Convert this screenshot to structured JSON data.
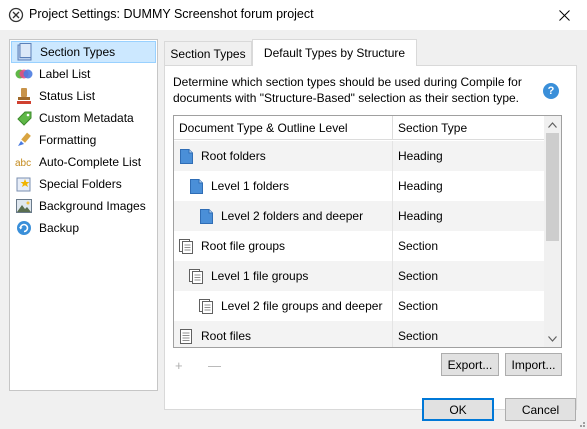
{
  "window": {
    "title": "Project Settings: DUMMY Screenshot forum project",
    "app_icon": "scrivener-app-icon",
    "close_icon": "close-icon"
  },
  "sidebar": {
    "items": [
      {
        "label": "Section Types",
        "icon": "section-types-icon",
        "selected": true
      },
      {
        "label": "Label List",
        "icon": "label-list-icon",
        "selected": false
      },
      {
        "label": "Status List",
        "icon": "status-list-icon",
        "selected": false
      },
      {
        "label": "Custom Metadata",
        "icon": "custom-metadata-icon",
        "selected": false
      },
      {
        "label": "Formatting",
        "icon": "formatting-icon",
        "selected": false
      },
      {
        "label": "Auto-Complete List",
        "icon": "auto-complete-icon",
        "selected": false
      },
      {
        "label": "Special Folders",
        "icon": "special-folders-icon",
        "selected": false
      },
      {
        "label": "Background Images",
        "icon": "background-images-icon",
        "selected": false
      },
      {
        "label": "Backup",
        "icon": "backup-icon",
        "selected": false
      }
    ]
  },
  "tabs": [
    {
      "label": "Section Types",
      "active": false
    },
    {
      "label": "Default Types by Structure",
      "active": true
    }
  ],
  "panel": {
    "description": "Determine which section types should be used during Compile for documents with \"Structure-Based\" selection as their section type.",
    "help_icon": "?",
    "table": {
      "columns": [
        "Document Type & Outline Level",
        "Section Type"
      ],
      "rows": [
        {
          "label": "Root folders",
          "section_type": "Heading",
          "icon": "folder-icon"
        },
        {
          "label": "Level 1 folders",
          "section_type": "Heading",
          "icon": "folder-icon"
        },
        {
          "label": "Level 2 folders and deeper",
          "section_type": "Heading",
          "icon": "folder-icon"
        },
        {
          "label": "Root file groups",
          "section_type": "Section",
          "icon": "file-group-icon"
        },
        {
          "label": "Level 1 file groups",
          "section_type": "Section",
          "icon": "file-group-icon"
        },
        {
          "label": "Level 2 file groups and deeper",
          "section_type": "Section",
          "icon": "file-group-icon"
        },
        {
          "label": "Root files",
          "section_type": "Section",
          "icon": "file-icon"
        }
      ]
    },
    "add_label": "+",
    "remove_label": "—",
    "export_label": "Export...",
    "import_label": "Import..."
  },
  "footer": {
    "ok_label": "OK",
    "cancel_label": "Cancel"
  },
  "colors": {
    "selection_bg": "#cce8ff",
    "selection_border": "#99d1ff",
    "folder_blue": "#4a8fd8",
    "default_button_border": "#0078d7"
  }
}
